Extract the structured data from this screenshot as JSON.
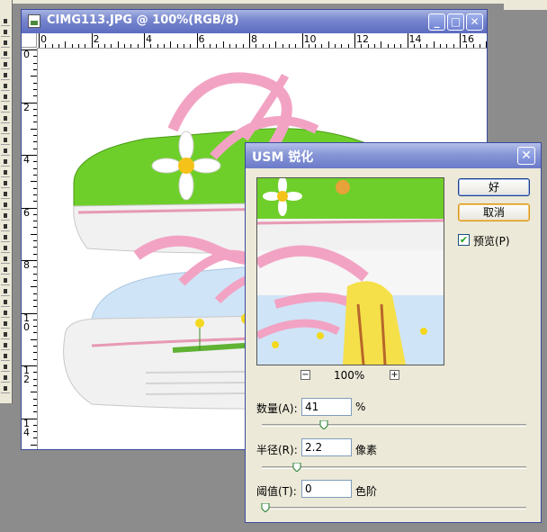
{
  "document": {
    "title": "CIMG113.JPG @ 100%(RGB/8)",
    "ruler_h": [
      "0",
      "2",
      "4",
      "6",
      "8",
      "10",
      "12",
      "14",
      "16"
    ],
    "ruler_v": [
      "0",
      "2",
      "4",
      "6",
      "8",
      "1\n0",
      "1\n2",
      "1\n4"
    ]
  },
  "dialog": {
    "title": "USM 锐化",
    "ok_label": "好",
    "cancel_label": "取消",
    "preview_label": "预览(P)",
    "preview_checked": true,
    "zoom": "100%",
    "zoom_out": "−",
    "zoom_in": "+",
    "amount": {
      "label": "数量(A):",
      "value": "41",
      "unit": "%",
      "slider_fraction": 0.22
    },
    "radius": {
      "label": "半径(R):",
      "value": "2.2",
      "unit": "像素",
      "slider_fraction": 0.12
    },
    "threshold": {
      "label": "阈值(T):",
      "value": "0",
      "unit": "色阶",
      "slider_fraction": 0.0
    }
  },
  "colors": {
    "titlebar": "#7988cf",
    "shoe_green": "#6fcf2a",
    "lace_pink": "#f2a3c4",
    "sole_white": "#eeeeee",
    "sky_blue": "#cfe4f7"
  }
}
